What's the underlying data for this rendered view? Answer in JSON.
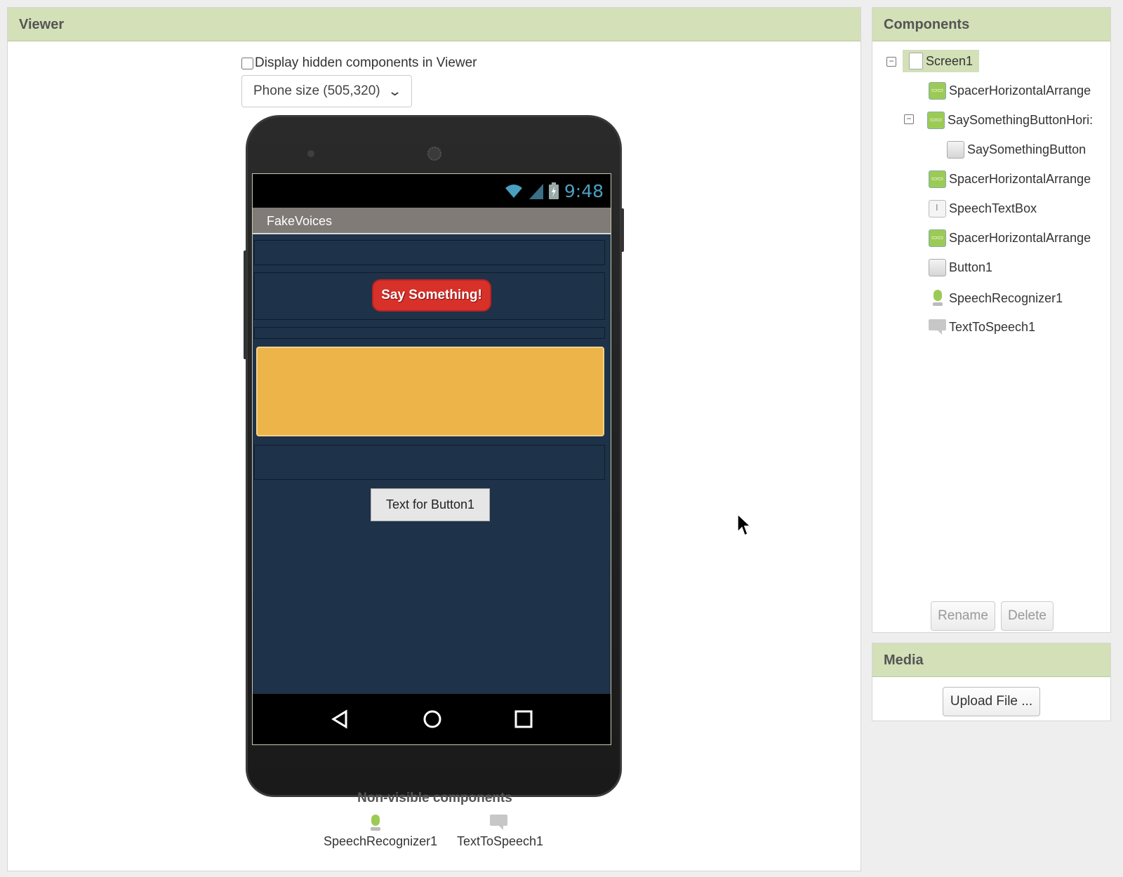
{
  "viewer": {
    "title": "Viewer",
    "hidden_checkbox_label": "Display hidden components in Viewer",
    "hidden_checkbox_checked": false,
    "size_select": "Phone size (505,320)"
  },
  "phone": {
    "clock": "9:48",
    "app_title": "FakeVoices",
    "say_button_label": "Say Something!",
    "button1_label": "Text for Button1",
    "textbox_color": "#edb44a",
    "screen_bg_color": "#1e3249",
    "say_button_color": "#d8312a"
  },
  "nonvisible": {
    "title": "Non-visible components",
    "items": [
      {
        "label": "SpeechRecognizer1",
        "icon": "microphone-icon"
      },
      {
        "label": "TextToSpeech1",
        "icon": "speech-bubble-icon"
      }
    ]
  },
  "components": {
    "title": "Components",
    "tree": [
      {
        "label": "Screen1",
        "icon": "screen-icon",
        "selected": true
      },
      {
        "label": "SpacerHorizontalArrange",
        "icon": "horizontal-arrangement-icon"
      },
      {
        "label": "SaySomethingButtonHori:",
        "icon": "horizontal-arrangement-icon"
      },
      {
        "label": "SaySomethingButton",
        "icon": "button-icon"
      },
      {
        "label": "SpacerHorizontalArrange",
        "icon": "horizontal-arrangement-icon"
      },
      {
        "label": "SpeechTextBox",
        "icon": "textbox-icon"
      },
      {
        "label": "SpacerHorizontalArrange",
        "icon": "horizontal-arrangement-icon"
      },
      {
        "label": "Button1",
        "icon": "button-icon"
      },
      {
        "label": "SpeechRecognizer1",
        "icon": "microphone-icon"
      },
      {
        "label": "TextToSpeech1",
        "icon": "speech-bubble-icon"
      }
    ],
    "rename_label": "Rename",
    "delete_label": "Delete"
  },
  "media": {
    "title": "Media",
    "upload_label": "Upload File ..."
  },
  "colors": {
    "panel_header": "#d3e0b8",
    "accent_green": "#9ccb55"
  }
}
